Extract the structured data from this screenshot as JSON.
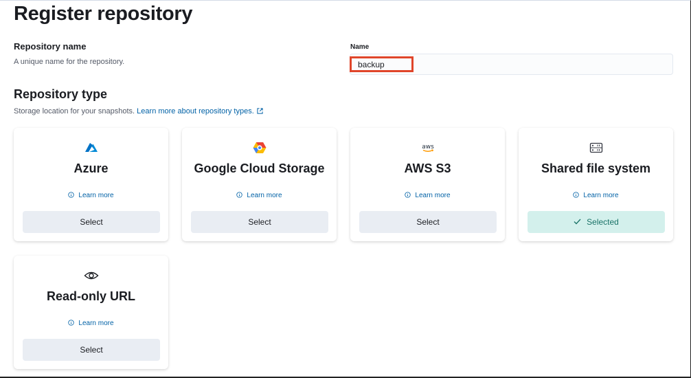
{
  "page": {
    "title": "Register repository"
  },
  "repo_name": {
    "title": "Repository name",
    "description": "A unique name for the repository.",
    "field_label": "Name",
    "value": "backup"
  },
  "repo_type": {
    "title": "Repository type",
    "description": "Storage location for your snapshots.",
    "learn_link": "Learn more about repository types."
  },
  "cards": [
    {
      "title": "Azure",
      "icon": "azure-icon",
      "learn": "Learn more",
      "button": "Select",
      "selected": false
    },
    {
      "title": "Google Cloud Storage",
      "icon": "google-cloud-icon",
      "learn": "Learn more",
      "button": "Select",
      "selected": false
    },
    {
      "title": "AWS S3",
      "icon": "aws-icon",
      "icon_text": "aws",
      "learn": "Learn more",
      "button": "Select",
      "selected": false
    },
    {
      "title": "Shared file system",
      "icon": "storage-icon",
      "learn": "Learn more",
      "button": "Selected",
      "selected": true
    },
    {
      "title": "Read-only URL",
      "icon": "eye-icon",
      "learn": "Learn more",
      "button": "Select",
      "selected": false
    }
  ],
  "colors": {
    "accent": "#0061a6",
    "selected_bg": "#d3f0ec",
    "selected_text": "#1a7368",
    "highlight": "#e0452a"
  }
}
